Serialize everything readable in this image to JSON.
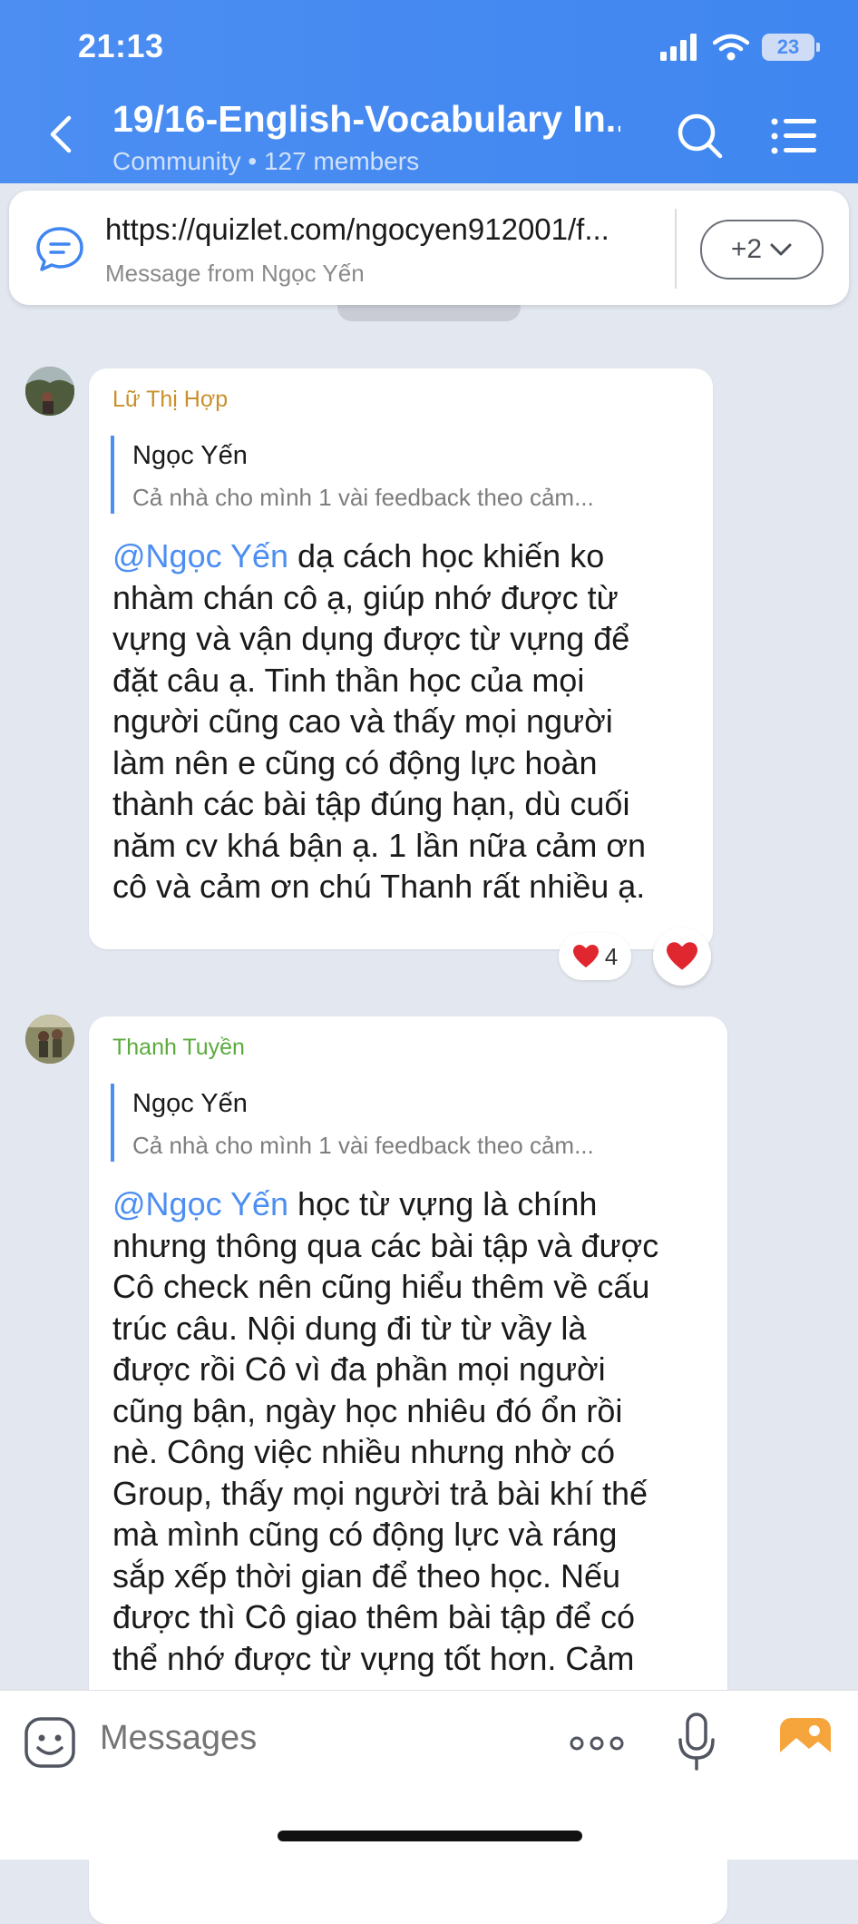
{
  "status_bar": {
    "time": "21:13",
    "battery": "23"
  },
  "header": {
    "title": "19/16-English-Vocabulary In...",
    "subtitle": "Community • 127 members"
  },
  "pinned": {
    "url": "https://quizlet.com/ngocyen912001/f...",
    "from": "Message from Ngọc Yến",
    "more_label": "+2"
  },
  "messages": [
    {
      "sender": "Lữ Thị Hợp",
      "sender_color": "#c8902a",
      "quote_name": "Ngọc Yến",
      "quote_text": "Cả nhà cho mình 1 vài feedback theo cảm...",
      "mention": "@Ngọc Yến",
      "lines": [
        " dạ cách học khiến ko",
        "nhàm chán cô ạ, giúp nhớ được từ",
        "vựng và vận dụng được từ vựng để",
        "đặt câu ạ. Tinh thần học của mọi",
        "người cũng cao và thấy mọi người",
        "làm nên e cũng có động lực hoàn",
        "thành các bài tập đúng hạn, dù cuối",
        "năm cv khá bận ạ. 1 lần nữa cảm ơn",
        "cô và cảm ơn chú Thanh rất nhiều ạ."
      ],
      "reaction_count": "4"
    },
    {
      "sender": "Thanh Tuyền",
      "sender_color": "#5aab3c",
      "quote_name": "Ngọc Yến",
      "quote_text": "Cả nhà cho mình 1 vài feedback theo cảm...",
      "mention": "@Ngọc Yến",
      "lines": [
        " học từ vựng là chính",
        "nhưng thông qua các bài tập và được",
        "Cô check nên cũng hiểu thêm về cấu",
        "trúc câu. Nội dung đi từ từ vầy là",
        "được rồi Cô vì đa phần mọi người",
        "cũng bận, ngày học nhiêu đó ổn rồi",
        "nè. Công việc nhiều nhưng nhờ có",
        "Group, thấy mọi người trả bài khí thế",
        "mà mình cũng có động lực và ráng",
        "sắp xếp thời gian để theo học. Nếu",
        "được thì Cô giao thêm bài tập để có",
        "thể nhớ được từ vựng tốt hơn. Cảm"
      ]
    }
  ],
  "composer": {
    "placeholder": "Messages"
  },
  "colors": {
    "header": "#4c8ef2",
    "mention": "#4c8ef2",
    "heart": "#e0262f"
  },
  "icons": [
    "back-chevron-icon",
    "search-icon",
    "menu-list-icon",
    "chat-bubble-icon",
    "chevron-down-icon",
    "heart-icon",
    "sticker-icon",
    "more-dots-icon",
    "microphone-icon",
    "gallery-icon"
  ]
}
